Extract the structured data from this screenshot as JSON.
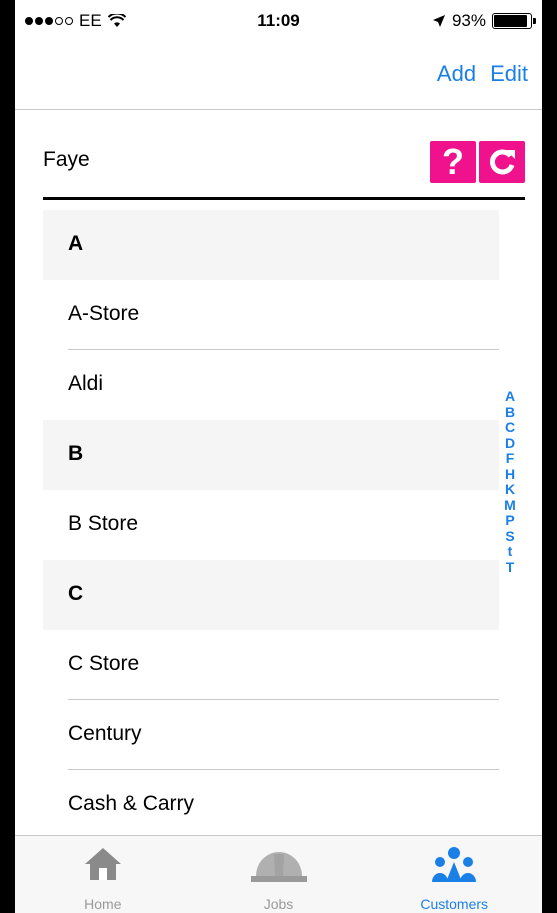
{
  "status_bar": {
    "carrier": "EE",
    "time": "11:09",
    "battery": "93%",
    "battery_level": 0.93
  },
  "nav": {
    "add_label": "Add",
    "edit_label": "Edit"
  },
  "filter": {
    "name": "Faye",
    "help_label": "?",
    "icons": {
      "help": "question-mark-icon",
      "refresh": "refresh-icon"
    }
  },
  "list": {
    "rows": [
      {
        "type": "section",
        "label": "A"
      },
      {
        "type": "item",
        "label": "A-Store"
      },
      {
        "type": "item",
        "label": "Aldi"
      },
      {
        "type": "section",
        "label": "B"
      },
      {
        "type": "item",
        "label": "B Store"
      },
      {
        "type": "section",
        "label": "C"
      },
      {
        "type": "item",
        "label": "C Store"
      },
      {
        "type": "item",
        "label": "Century"
      },
      {
        "type": "item",
        "label": "Cash & Carry"
      }
    ]
  },
  "index": [
    "A",
    "B",
    "C",
    "D",
    "F",
    "H",
    "K",
    "M",
    "P",
    "S",
    "t",
    "T"
  ],
  "tabs": [
    {
      "label": "Home",
      "icon": "house-icon",
      "active": false
    },
    {
      "label": "Jobs",
      "icon": "hard-hat-icon",
      "active": false
    },
    {
      "label": "Customers",
      "icon": "people-group-icon",
      "active": true
    }
  ],
  "colors": {
    "accent": "#1a7fe6",
    "brand": "#f0118c",
    "inactive": "#999999"
  }
}
